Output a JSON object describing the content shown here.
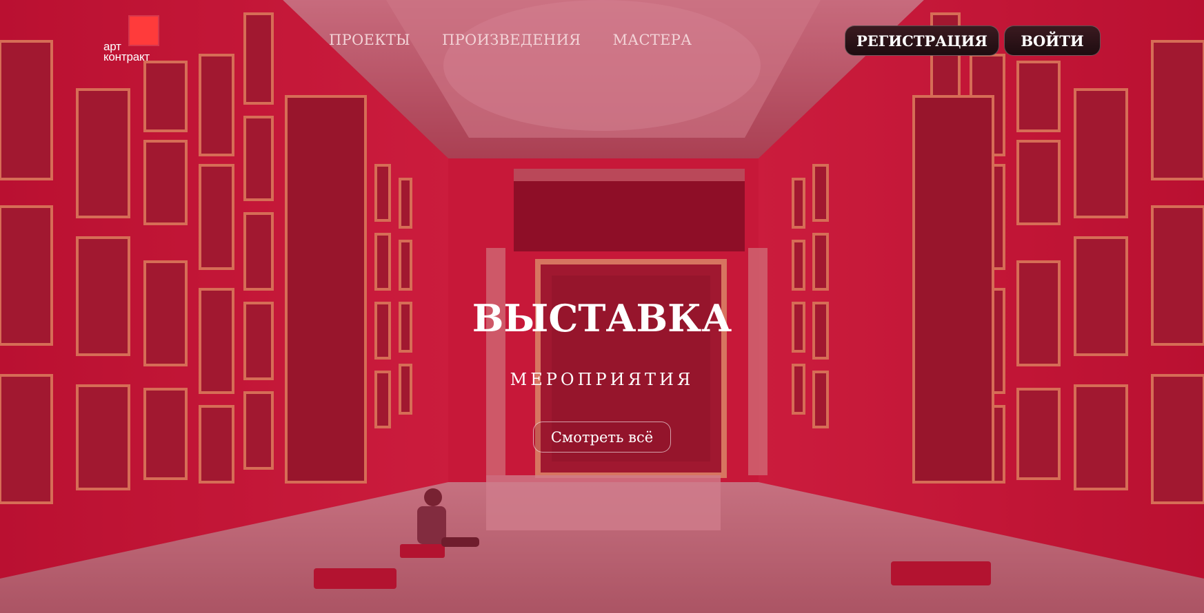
{
  "logo": {
    "text": "арт\nконтракт",
    "accent_color": "#ff3b3b"
  },
  "nav": {
    "items": [
      {
        "label": "ПРОЕКТЫ"
      },
      {
        "label": "ПРОИЗВЕДЕНИЯ"
      },
      {
        "label": "МАСТЕРА"
      }
    ]
  },
  "auth": {
    "register_label": "РЕГИСТРАЦИЯ",
    "login_label": "ВОЙТИ"
  },
  "hero": {
    "title": "ВЫСТАВКА",
    "subtitle": "МЕРОПРИЯТИЯ",
    "cta_label": "Смотреть всё",
    "overlay_color": "#c41438"
  }
}
